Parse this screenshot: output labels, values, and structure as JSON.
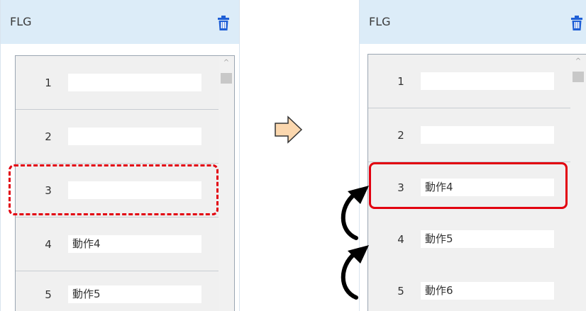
{
  "colors": {
    "header_bg": "#dcecf8",
    "trash_icon": "#1f5fd6",
    "row_bg": "#f0f0f0",
    "highlight": "#e2000f",
    "next_arrow_fill": "#fbd7ae",
    "next_arrow_stroke": "#333333"
  },
  "icons": {
    "delete": "trash-icon",
    "transition": "right-arrow-icon",
    "move_up": "curved-up-arrow-icon"
  },
  "before": {
    "header": {
      "title": "FLG"
    },
    "rows": [
      {
        "num": "1",
        "value": ""
      },
      {
        "num": "2",
        "value": ""
      },
      {
        "num": "3",
        "value": ""
      },
      {
        "num": "4",
        "value": "動作4"
      },
      {
        "num": "5",
        "value": "動作5"
      }
    ]
  },
  "after": {
    "header": {
      "title": "FLG"
    },
    "rows": [
      {
        "num": "1",
        "value": ""
      },
      {
        "num": "2",
        "value": ""
      },
      {
        "num": "3",
        "value": "動作4"
      },
      {
        "num": "4",
        "value": "動作5"
      },
      {
        "num": "5",
        "value": "動作6"
      }
    ]
  }
}
